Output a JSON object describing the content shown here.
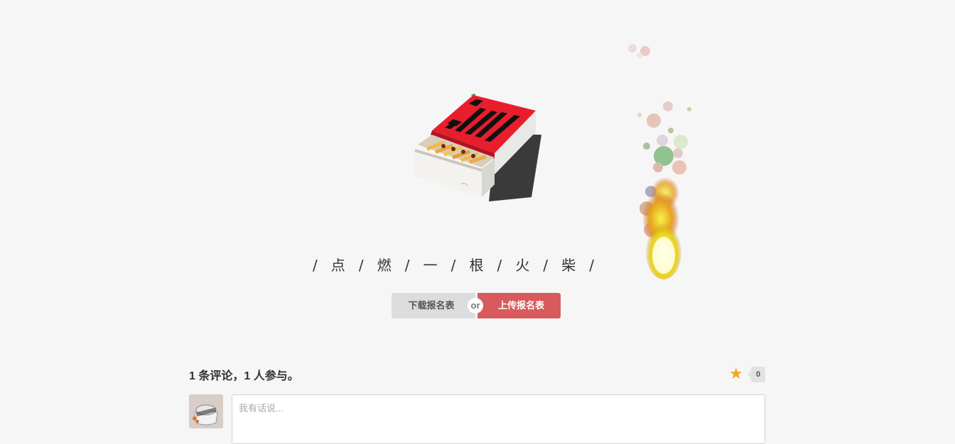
{
  "hero": {
    "slogan": "/   点   /   燃   /   一   /   根   /   火   /   柴   /"
  },
  "actions": {
    "download_label": "下载报名表",
    "or_label": "or",
    "upload_label": "上传报名表"
  },
  "comments": {
    "title": "1 条评论，1 人参与。",
    "rating_count": "0",
    "input_placeholder": "我有话说..."
  },
  "colors": {
    "background": "#f6f6f6",
    "download_button": "#dcdcdc",
    "upload_button": "#d95a5c",
    "star": "#f2a623"
  },
  "icons": {
    "rating": "star-icon"
  }
}
